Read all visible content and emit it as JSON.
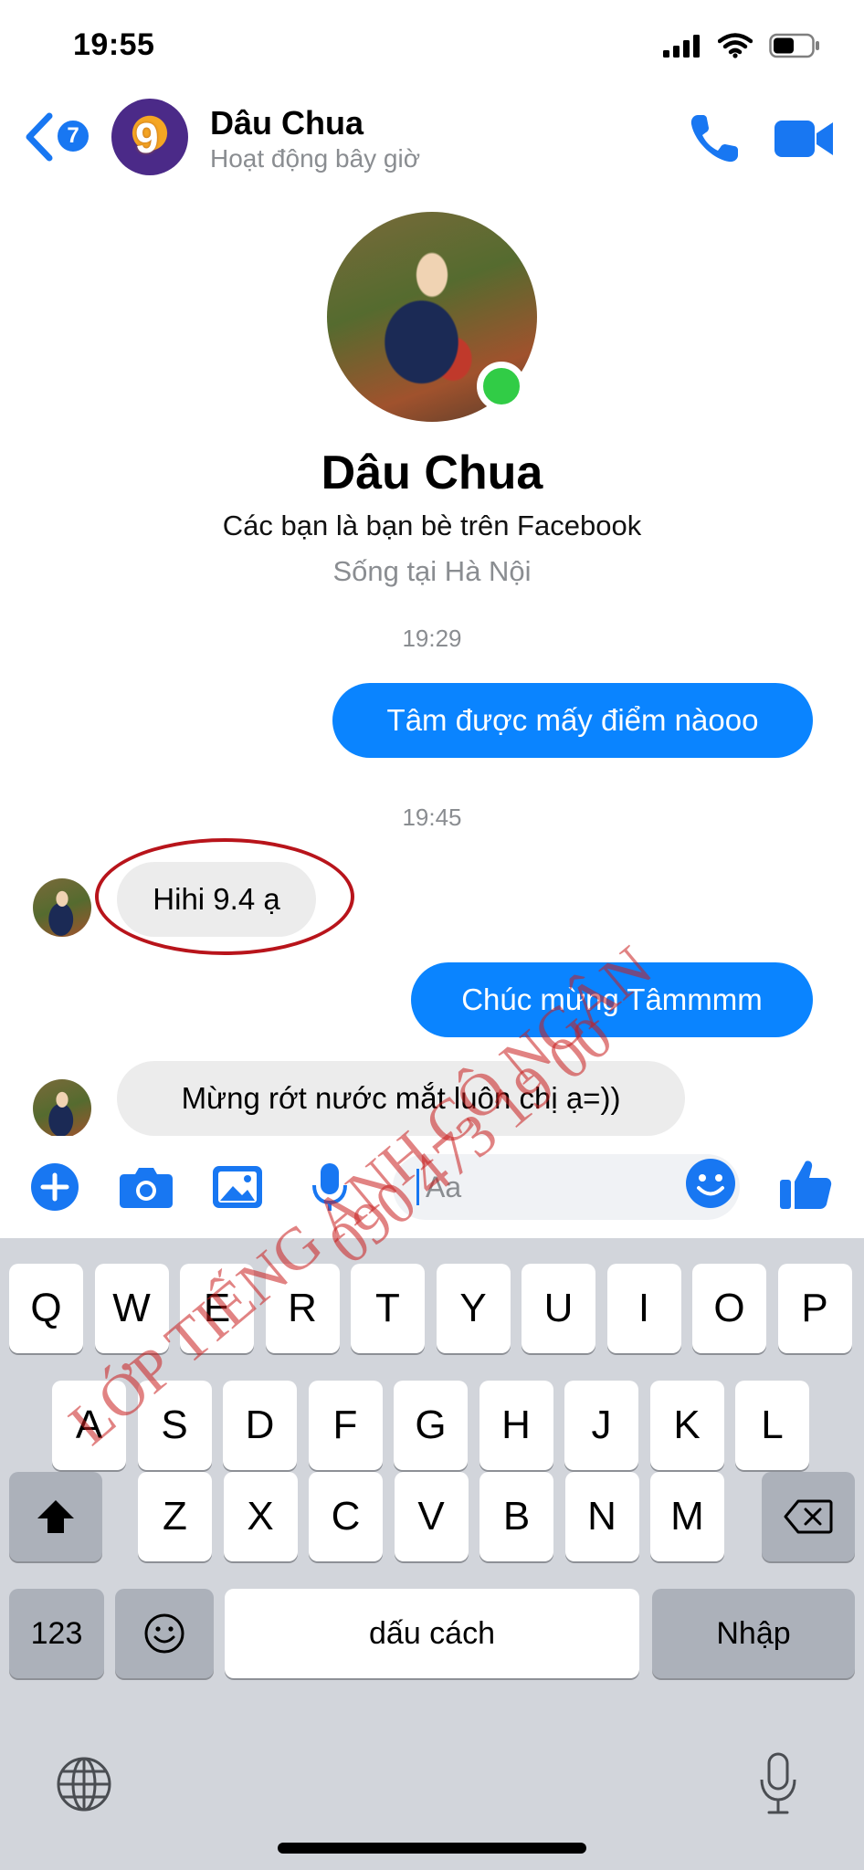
{
  "status_bar": {
    "time": "19:55"
  },
  "header": {
    "back_badge": "7",
    "contact_name": "Dâu Chua",
    "contact_status": "Hoạt động bây giờ",
    "avatar_text": "9"
  },
  "profile": {
    "name": "Dâu Chua",
    "friend_note": "Các bạn là bạn bè trên Facebook",
    "location": "Sống tại Hà Nội"
  },
  "messages": {
    "time_1": "19:29",
    "out_1": "Tâm được mấy điểm nàooo",
    "time_2": "19:45",
    "in_1": "Hihi 9.4 ạ",
    "out_2": "Chúc mừng Tâmmmm",
    "in_2": "Mừng rớt nước mắt luôn chị ạ=))"
  },
  "input": {
    "placeholder": "Aa"
  },
  "keyboard": {
    "row1": [
      "Q",
      "W",
      "E",
      "R",
      "T",
      "Y",
      "U",
      "I",
      "O",
      "P"
    ],
    "row2": [
      "A",
      "S",
      "D",
      "F",
      "G",
      "H",
      "J",
      "K",
      "L"
    ],
    "row3": [
      "Z",
      "X",
      "C",
      "V",
      "B",
      "N",
      "M"
    ],
    "numbers_label": "123",
    "space_label": "dấu cách",
    "return_label": "Nhập"
  },
  "watermark": {
    "line1": "LỚP TIẾNG ANH CÔ NGÂN",
    "line2": "090 473 19 00"
  },
  "colors": {
    "messenger_blue": "#0a84ff",
    "online_green": "#31cc46",
    "annotation_red": "#b8141b"
  }
}
